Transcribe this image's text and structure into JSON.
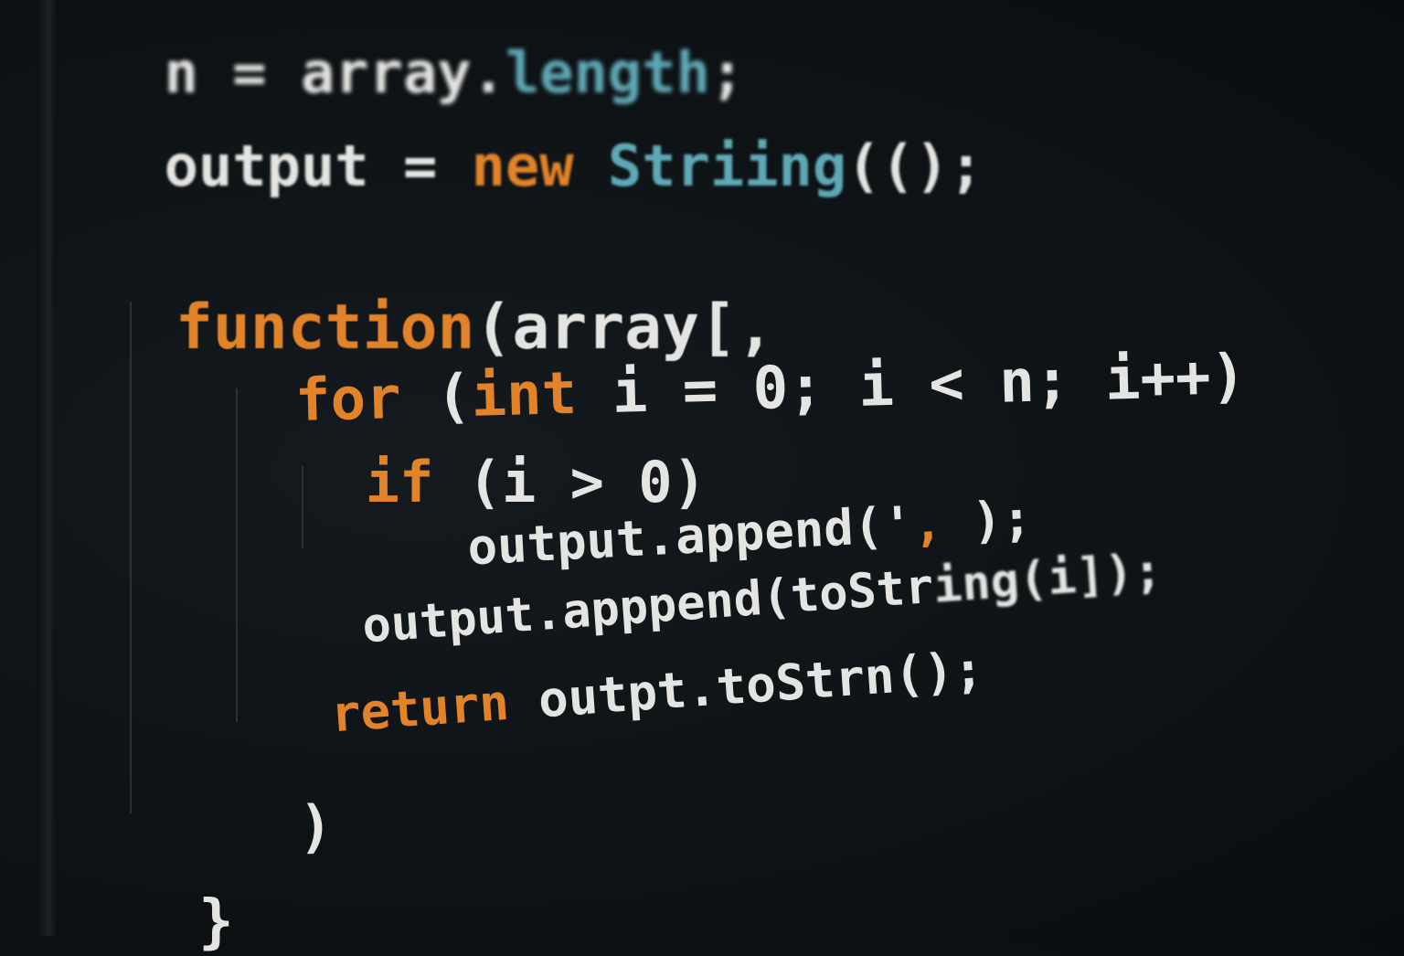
{
  "code_lines": [
    {
      "a": "n = array.",
      "b": "length",
      "c": ";"
    },
    {
      "a": "output = ",
      "b": "new",
      "c": " ",
      "d": "Striing",
      "e": "(();"
    },
    {
      "a": "function",
      "b": "(array[,"
    },
    {
      "a": "for",
      "b": " (",
      "c": "int",
      "d": " i = 0; i < n; i++)"
    },
    {
      "a": "if",
      "b": " (i > 0)"
    },
    {
      "a": "output.append('",
      "b": ",",
      "c": " );"
    },
    {
      "a": "output.apppend(toStr",
      "b": "ing(i]);"
    },
    {
      "a": "return",
      "b": " outpt.toStrn();"
    },
    {
      "a": ")"
    },
    {
      "a": "}"
    }
  ],
  "colors": {
    "background": "#0e1316",
    "text": "#e4e4e2",
    "keyword": "#e2832a",
    "type": "#5fa9b6"
  }
}
